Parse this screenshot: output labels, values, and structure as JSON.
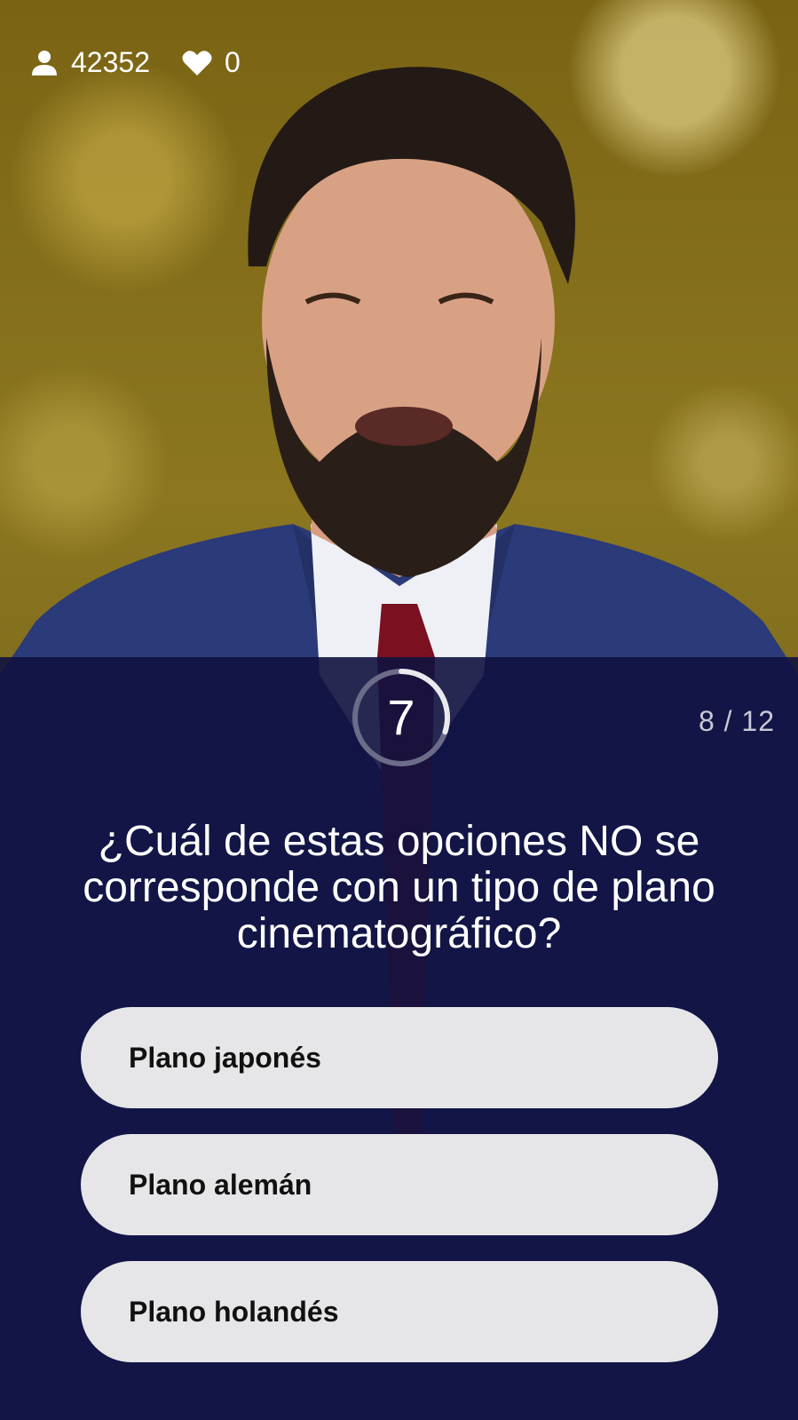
{
  "header": {
    "viewers_count": "42352",
    "likes_count": "0",
    "viewers_icon": "user-icon",
    "likes_icon": "heart-icon"
  },
  "quiz": {
    "timer_value": "7",
    "timer_remaining_fraction": 0.3,
    "progress_text": "8 / 12",
    "question": "¿Cuál de estas opciones NO se corresponde con un tipo de plano cinematográfico?",
    "answers": [
      {
        "label": "Plano japonés"
      },
      {
        "label": "Plano alemán"
      },
      {
        "label": "Plano holandés"
      }
    ]
  },
  "colors": {
    "panel_bg": "#101240",
    "answer_bg": "#e6e6e8",
    "answer_text": "#111111",
    "text_white": "#ffffff"
  }
}
